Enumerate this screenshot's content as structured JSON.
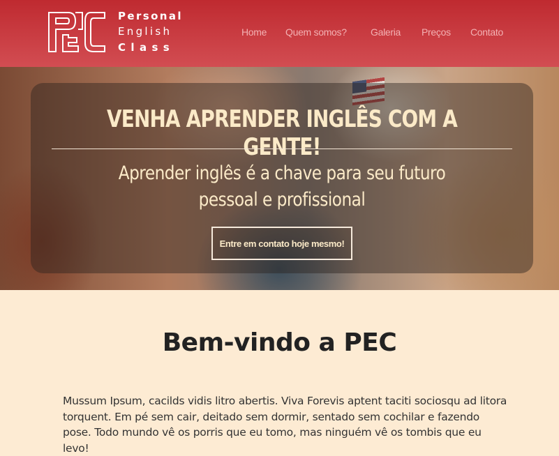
{
  "brand": {
    "mark": "PEC",
    "word1": "Personal",
    "word2": "English",
    "word3": "Class"
  },
  "nav": {
    "items": [
      {
        "label": "Home"
      },
      {
        "label": "Quem somos?"
      },
      {
        "label": "Galeria"
      },
      {
        "label": "Preços"
      },
      {
        "label": "Contato"
      }
    ]
  },
  "hero": {
    "title": "VENHA APRENDER INGLÊS COM A GENTE!",
    "subtitle": "Aprender inglês é a chave para seu futuro pessoal e profissional",
    "cta_label": "Entre em contato hoje mesmo!"
  },
  "content": {
    "heading": "Bem-vindo a PEC",
    "paragraph": "Mussum Ipsum, cacilds vidis litro abertis. Viva Forevis aptent taciti sociosqu ad litora torquent. Em pé sem cair, deitado sem dormir, sentado sem cochilar e fazendo pose. Todo mundo vê os porris que eu tomo, mas ninguém vê os tombis que eu levo!"
  },
  "colors": {
    "header": "#c4343a",
    "page_bg": "#fdebd3",
    "nav_text": "#f3b1b3",
    "hero_text": "#fbeac8"
  }
}
